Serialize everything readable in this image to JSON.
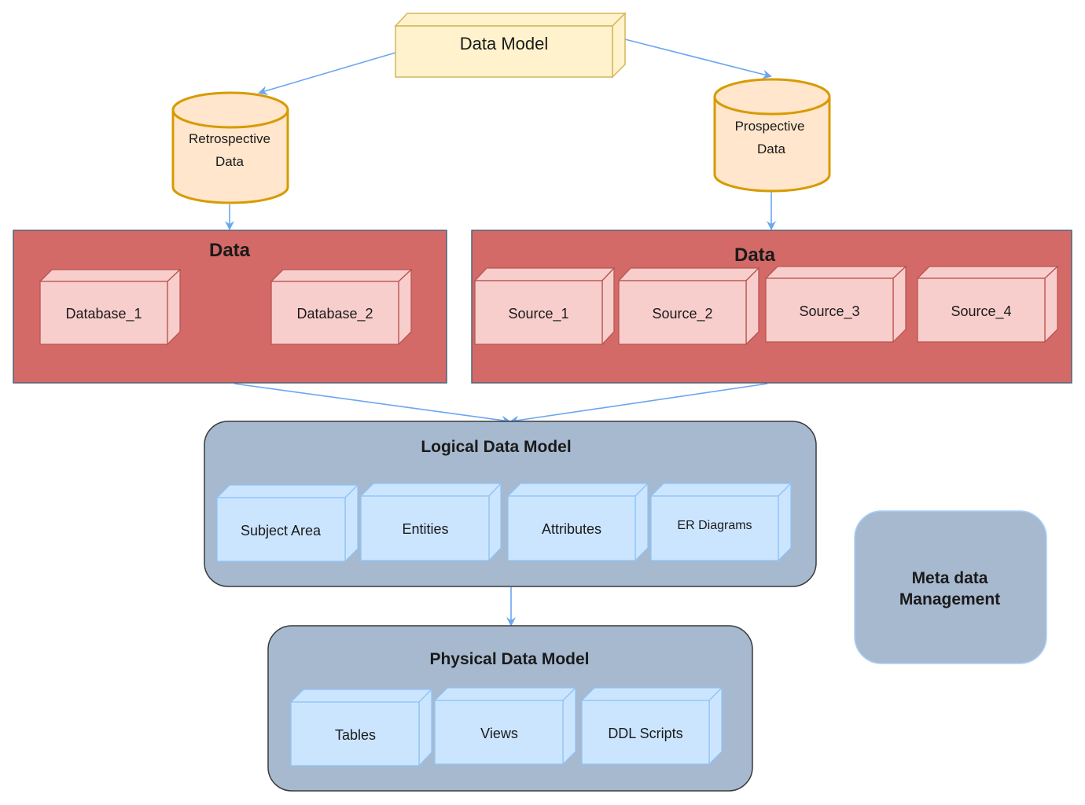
{
  "diagram": {
    "data_model": {
      "label": "Data Model"
    },
    "retrospective": {
      "line1": "Retrospective",
      "line2": "Data"
    },
    "prospective": {
      "line1": "Prospective",
      "line2": "Data"
    },
    "data_left": {
      "title": "Data",
      "items": [
        "Database_1",
        "Database_2"
      ]
    },
    "data_right": {
      "title": "Data",
      "items": [
        "Source_1",
        "Source_2",
        "Source_3",
        "Source_4"
      ]
    },
    "logical": {
      "title": "Logical Data Model",
      "items": [
        "Subject Area",
        "Entities",
        "Attributes",
        "ER Diagrams"
      ]
    },
    "physical": {
      "title": "Physical Data Model",
      "items": [
        "Tables",
        "Views",
        "DDL Scripts"
      ]
    },
    "metadata": {
      "line1": "Meta data",
      "line2": "Management"
    }
  },
  "colors": {
    "yellow_fill": "#fff2cc",
    "yellow_stroke": "#d6b656",
    "orange_fill": "#ffe6cc",
    "orange_stroke": "#d79b00",
    "red_fill": "#d36a68",
    "red_border": "#4f6377",
    "pink_fill": "#f8cecc",
    "pink_stroke": "#b85450",
    "slate_fill": "#a6b9cf",
    "slate_stroke": "#3a3a3a",
    "blue_fill": "#cce5ff",
    "blue_stroke": "#8ec3f5",
    "arrow": "#6aa6f0"
  }
}
